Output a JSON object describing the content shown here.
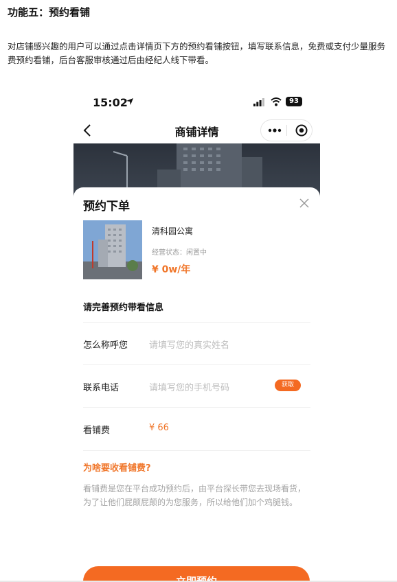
{
  "document": {
    "heading": "功能五：预约看铺",
    "paragraph": "对店铺感兴趣的用户可以通过点击详情页下方的预约看铺按钮，填写联系信息，免费或支付少量服务费预约看铺，后台客服审核通过后由经纪人线下带看。"
  },
  "phone": {
    "status_bar": {
      "time": "15:02",
      "battery": "93"
    },
    "nav": {
      "title": "商铺详情"
    },
    "sheet": {
      "title": "预约下单",
      "property": {
        "name": "清科园公寓",
        "status": "经营状态：闲置中",
        "price": "¥ 0w/年"
      },
      "section_title": "请完善预约带看信息",
      "name_field": {
        "label": "怎么称呼您",
        "placeholder": "请填写您的真实姓名"
      },
      "phone_field": {
        "label": "联系电话",
        "placeholder": "请填写您的手机号码",
        "get_button": "获取"
      },
      "fee": {
        "label": "看铺费",
        "value": "¥ 66"
      },
      "why": {
        "title": "为啥要收看铺费?",
        "text": "看铺费是您在平台成功预约后，由平台探长带您去现场看货， 为了让他们屁颠屁颠的为您服务，所以给他们加个鸡腿钱。"
      },
      "submit_button": "立即预约"
    }
  },
  "colors": {
    "accent": "#f46a22",
    "price": "#f0762a",
    "placeholder": "#bdbdbd"
  }
}
